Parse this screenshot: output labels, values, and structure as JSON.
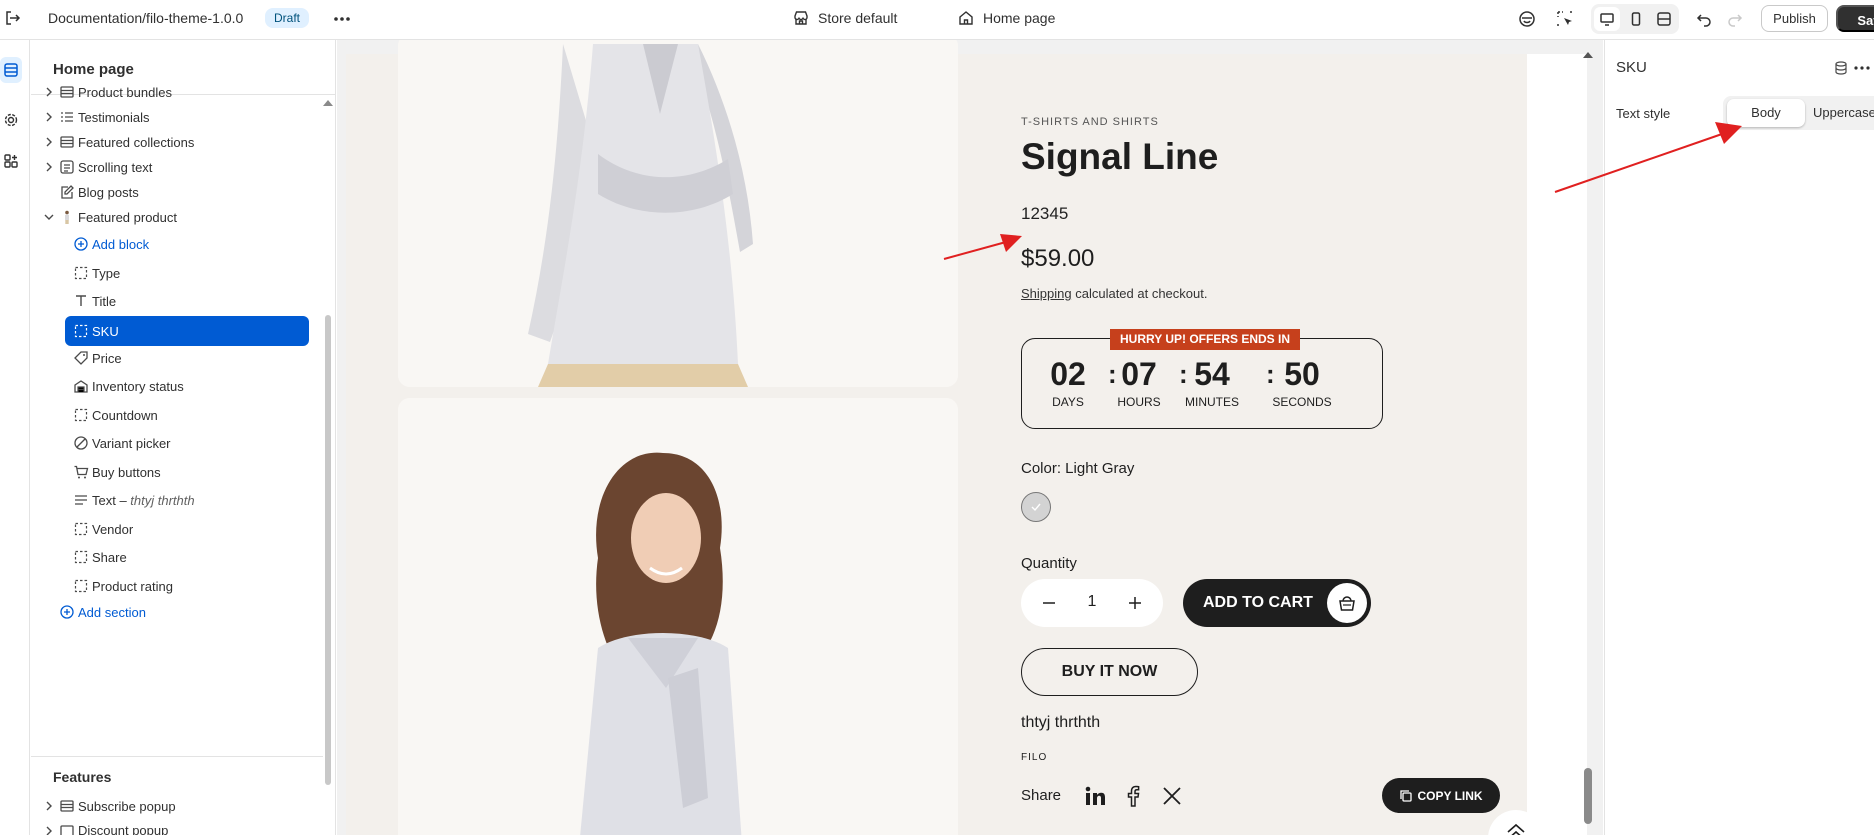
{
  "topbar": {
    "theme_title": "Documentation/filo-theme-1.0.0",
    "status_badge": "Draft",
    "store_label": "Store default",
    "page_label": "Home page",
    "publish_label": "Publish",
    "save_label": "Save"
  },
  "sidebar": {
    "title": "Home page",
    "items": [
      {
        "label": "Product bundles",
        "icon": "section-icon"
      },
      {
        "label": "Testimonials",
        "icon": "list-icon"
      },
      {
        "label": "Featured collections",
        "icon": "section-icon"
      },
      {
        "label": "Scrolling text",
        "icon": "text-section-icon"
      },
      {
        "label": "Blog posts",
        "icon": "blog-icon"
      },
      {
        "label": "Featured product",
        "icon": "product-icon"
      }
    ],
    "add_block": "Add block",
    "blocks": [
      {
        "label": "Type",
        "icon": "block-frame-icon"
      },
      {
        "label": "Title",
        "icon": "title-icon"
      },
      {
        "label": "SKU",
        "icon": "block-frame-icon"
      },
      {
        "label": "Price",
        "icon": "price-tag-icon"
      },
      {
        "label": "Inventory status",
        "icon": "inventory-icon"
      },
      {
        "label": "Countdown",
        "icon": "block-frame-icon"
      },
      {
        "label": "Variant picker",
        "icon": "variant-icon"
      },
      {
        "label": "Buy buttons",
        "icon": "cart-icon"
      },
      {
        "label": "Text – ",
        "icon": "text-lines-icon"
      },
      {
        "label": "Vendor",
        "icon": "block-frame-icon"
      },
      {
        "label": "Share",
        "icon": "block-frame-icon"
      },
      {
        "label": "Product rating",
        "icon": "block-frame-icon"
      }
    ],
    "text_block_detail": "thtyj thrthth",
    "add_section": "Add section",
    "features_title": "Features",
    "features_items": [
      {
        "label": "Subscribe popup",
        "icon": "section-icon"
      },
      {
        "label": "Discount popup",
        "icon": "section-icon"
      }
    ]
  },
  "product": {
    "type": "T-SHIRTS AND SHIRTS",
    "title": "Signal Line",
    "sku": "12345",
    "price": "$59.00",
    "shipping_link": "Shipping",
    "shipping_rest": " calculated at checkout.",
    "countdown_tag": "HURRY UP! OFFERS ENDS IN",
    "countdown": [
      {
        "value": "02",
        "label": "DAYS"
      },
      {
        "value": "07",
        "label": "HOURS"
      },
      {
        "value": "54",
        "label": "MINUTES"
      },
      {
        "value": "50",
        "label": "SECONDS"
      }
    ],
    "color_label": "Color: Light Gray",
    "swatch_color": "#d3d3d3",
    "quantity_label": "Quantity",
    "quantity_value": "1",
    "add_to_cart": "ADD TO CART",
    "buy_now": "BUY IT NOW",
    "text": "thtyj thrthth",
    "vendor": "FILO",
    "share_label": "Share",
    "copy_link": "COPY LINK"
  },
  "settings": {
    "title": "SKU",
    "text_style_label": "Text style",
    "options": [
      "Body",
      "Uppercase"
    ],
    "selected": "Body"
  },
  "colors": {
    "accent": "#005bd3",
    "countdown_tag": "#c6401c",
    "annotation_arrow": "#e02020",
    "product_bg": "#f3f0ec"
  }
}
